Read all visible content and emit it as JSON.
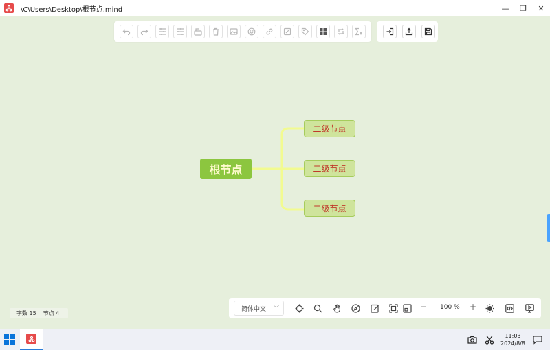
{
  "window": {
    "title": "\\C\\Users\\Desktop\\根节点.mind",
    "minimize": "—",
    "restore": "❐",
    "close": "✕"
  },
  "toolbar": {
    "main": [
      "undo",
      "redo",
      "insert-child",
      "insert-sibling",
      "insert-parent",
      "delete",
      "image",
      "emoji",
      "link",
      "note",
      "tag",
      "layout",
      "structure",
      "formula"
    ],
    "right": [
      "import",
      "export",
      "save"
    ]
  },
  "mindmap": {
    "root": "根节点",
    "children": [
      "二级节点",
      "二级节点",
      "二级节点"
    ],
    "colors": {
      "root_bg": "#8cc63f",
      "root_text": "#fffbd0",
      "child_bg": "#cfe49c",
      "child_border": "#a6cc5c",
      "child_text": "#c0392b",
      "line": "#f2fb90",
      "canvas": "#e6efdc"
    }
  },
  "status": {
    "word_count_label": "字数",
    "word_count": "15",
    "node_count_label": "节点",
    "node_count": "4"
  },
  "bottombar": {
    "language": "简体中文",
    "zoom_minus": "−",
    "zoom_value": "100",
    "zoom_unit": "%",
    "zoom_plus": "+"
  },
  "taskbar": {
    "time": "11:03",
    "date": "2024/8/8"
  }
}
